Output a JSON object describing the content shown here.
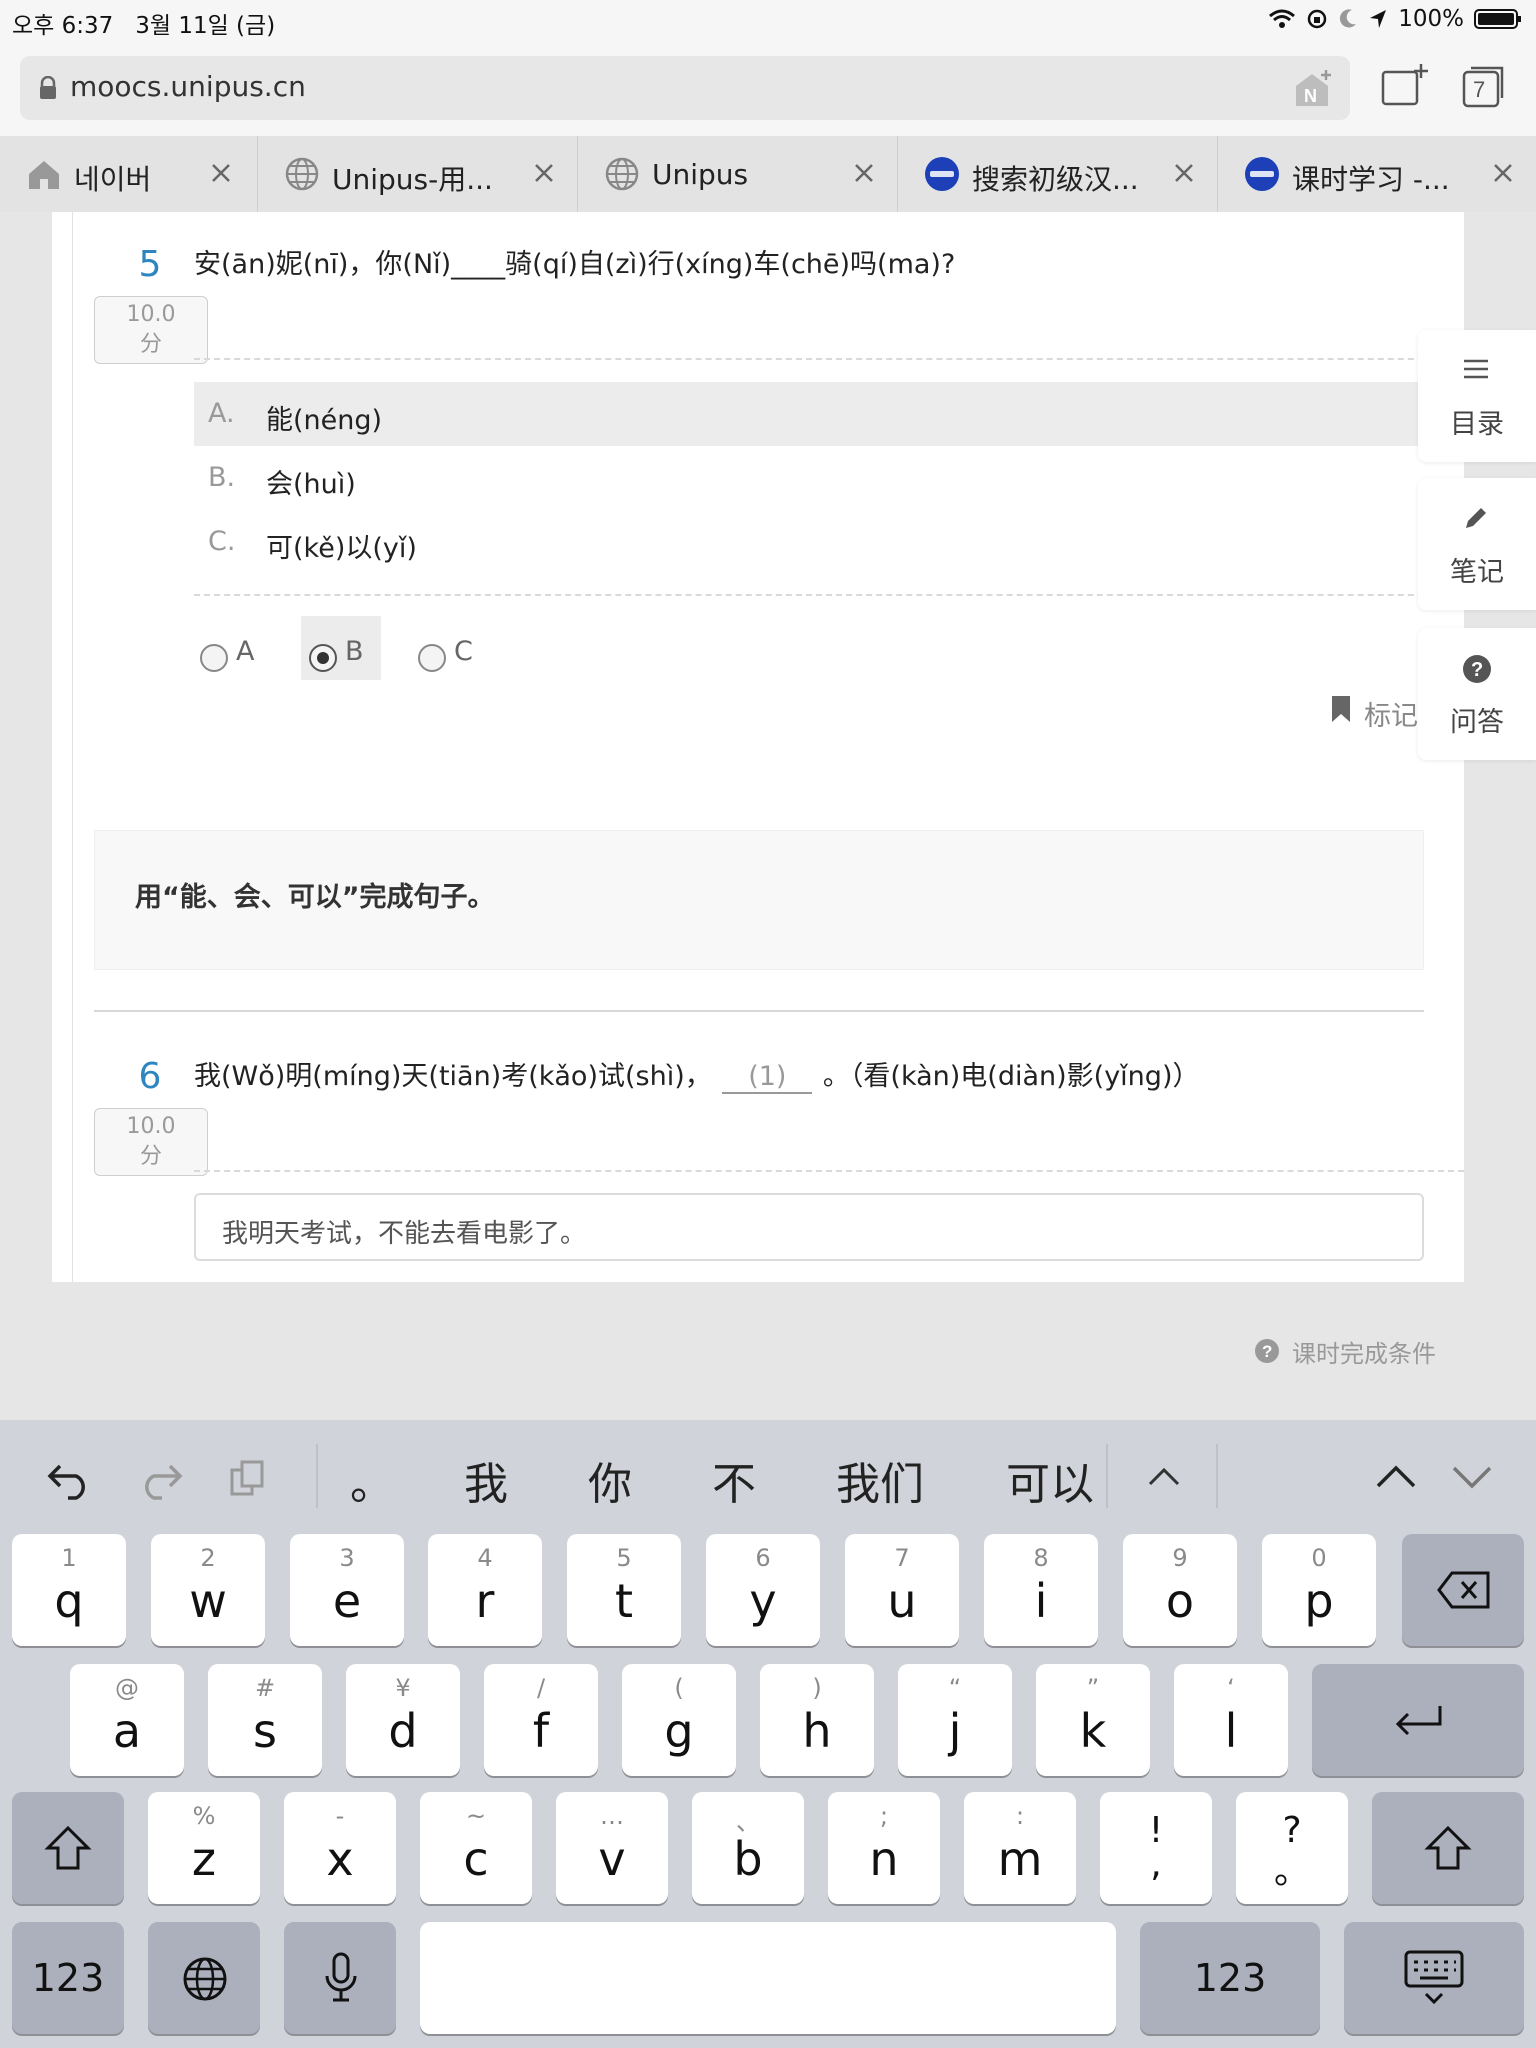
{
  "status_bar": {
    "time": "오후 6:37",
    "date": "3월 11일 (금)",
    "battery": "100%"
  },
  "browser": {
    "url": "moocs.unipus.cn",
    "tab_count": "7",
    "tabs": [
      {
        "label": "네이버",
        "icon": "home-icon"
      },
      {
        "label": "Unipus-用...",
        "icon": "globe-icon"
      },
      {
        "label": "Unipus",
        "icon": "globe-icon"
      },
      {
        "label": "搜索初级汉...",
        "icon": "unipus-logo-icon"
      },
      {
        "label": "课时学习 -...",
        "icon": "unipus-logo-icon"
      }
    ]
  },
  "question5": {
    "number": "5",
    "score_value": "10.0",
    "score_unit": "分",
    "text": "安(ān)妮(nī)，你(Nǐ)____骑(qí)自(zì)行(xíng)车(chē)吗(ma)?",
    "options": [
      {
        "letter": "A.",
        "text": "能(néng)"
      },
      {
        "letter": "B.",
        "text": "会(huì)"
      },
      {
        "letter": "C.",
        "text": "可(kě)以(yǐ)"
      }
    ],
    "radios": [
      "A",
      "B",
      "C"
    ],
    "selected": "B",
    "bookmark_label": "标记"
  },
  "side_nav": [
    {
      "label": "目录",
      "icon": "menu-icon"
    },
    {
      "label": "笔记",
      "icon": "pencil-icon"
    },
    {
      "label": "问答",
      "icon": "question-icon"
    }
  ],
  "instruction": "用“能、会、可以”完成句子。",
  "question6": {
    "number": "6",
    "score_value": "10.0",
    "score_unit": "分",
    "text_before": "我(Wǒ)明(míng)天(tiān)考(kǎo)试(shì)，",
    "blank": "(1)",
    "text_after": "。（看(kàn)电(diàn)影(yǐng)）",
    "answer": "我明天考试，不能去看电影了。"
  },
  "completion_link": "课时完成条件",
  "keyboard": {
    "candidates": [
      "。",
      "我",
      "你",
      "不",
      "我们",
      "可以"
    ],
    "row1": [
      [
        "1",
        "q"
      ],
      [
        "2",
        "w"
      ],
      [
        "3",
        "e"
      ],
      [
        "4",
        "r"
      ],
      [
        "5",
        "t"
      ],
      [
        "6",
        "y"
      ],
      [
        "7",
        "u"
      ],
      [
        "8",
        "i"
      ],
      [
        "9",
        "o"
      ],
      [
        "0",
        "p"
      ]
    ],
    "row2": [
      [
        "@",
        "a"
      ],
      [
        "#",
        "s"
      ],
      [
        "¥",
        "d"
      ],
      [
        "/",
        "f"
      ],
      [
        "(",
        "g"
      ],
      [
        ")",
        "h"
      ],
      [
        "“",
        "j"
      ],
      [
        "”",
        "k"
      ],
      [
        "‘",
        "l"
      ]
    ],
    "row3": [
      [
        "%",
        "z"
      ],
      [
        "-",
        "x"
      ],
      [
        "~",
        "c"
      ],
      [
        "…",
        "v"
      ],
      [
        "、",
        "b"
      ],
      [
        ";",
        "n"
      ],
      [
        ":",
        "m"
      ],
      [
        "!",
        ","
      ],
      [
        "?",
        "。"
      ]
    ],
    "numbers_label": "123"
  }
}
